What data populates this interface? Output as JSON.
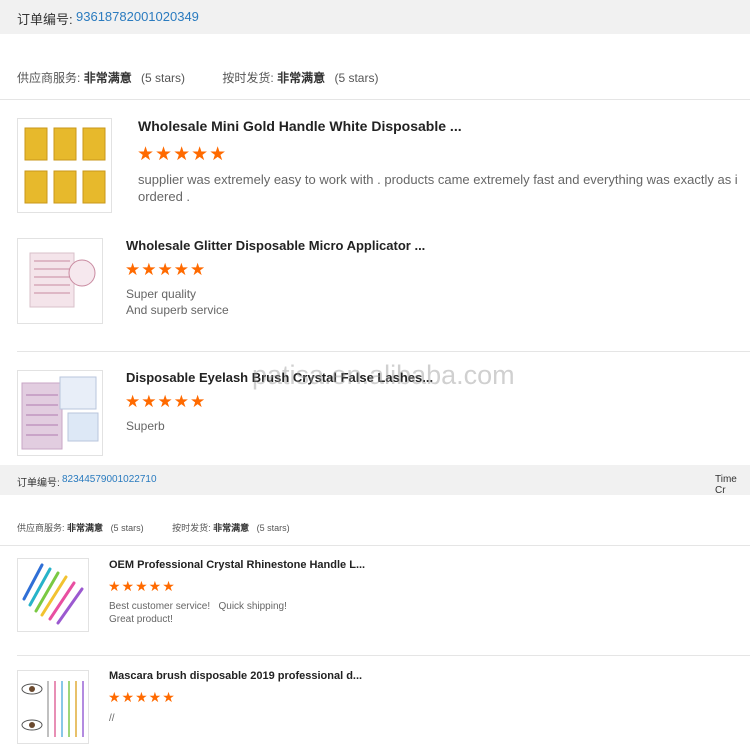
{
  "orders": [
    {
      "label": "订单编号:",
      "number": "93618782001020349",
      "rating": {
        "supplier_label": "供应商服务:",
        "supplier_value": "非常满意",
        "supplier_stars": "(5 stars)",
        "ship_label": "按时发货:",
        "ship_value": "非常满意",
        "ship_stars": "(5 stars)"
      },
      "items": [
        {
          "title": "Wholesale Mini Gold Handle White Disposable ...",
          "stars": "★★★★★",
          "comment": "supplier was extremely easy to work with . products came extremely fast and everything was exactly as i ordered ."
        },
        {
          "title": "Wholesale Glitter Disposable Micro Applicator ...",
          "stars": "★★★★★",
          "comment_lines": [
            "Super quality",
            "And superb service"
          ]
        },
        {
          "title": "Disposable Eyelash Brush Crystal False Lashes...",
          "stars": "★★★★★",
          "comment": "Superb"
        }
      ]
    },
    {
      "label": "订单编号:",
      "number": "82344579001022710",
      "time_label": "Time Cr",
      "rating": {
        "supplier_label": "供应商服务:",
        "supplier_value": "非常满意",
        "supplier_stars": "(5 stars)",
        "ship_label": "按时发货:",
        "ship_value": "非常满意",
        "ship_stars": "(5 stars)"
      },
      "items": [
        {
          "title": "OEM Professional Crystal Rhinestone Handle L...",
          "stars": "★★★★★",
          "comment_lines": [
            "Best customer service!   Quick shipping!",
            "Great product!"
          ]
        },
        {
          "title": "Mascara brush disposable 2019 professional d...",
          "stars": "★★★★★",
          "comment": "//"
        }
      ]
    }
  ],
  "watermark": "patisa.en.alibaba.com",
  "colors": {
    "accent_link": "#2a7bbf",
    "star": "#ff6a00",
    "bar_bg": "#f1f1f1"
  }
}
